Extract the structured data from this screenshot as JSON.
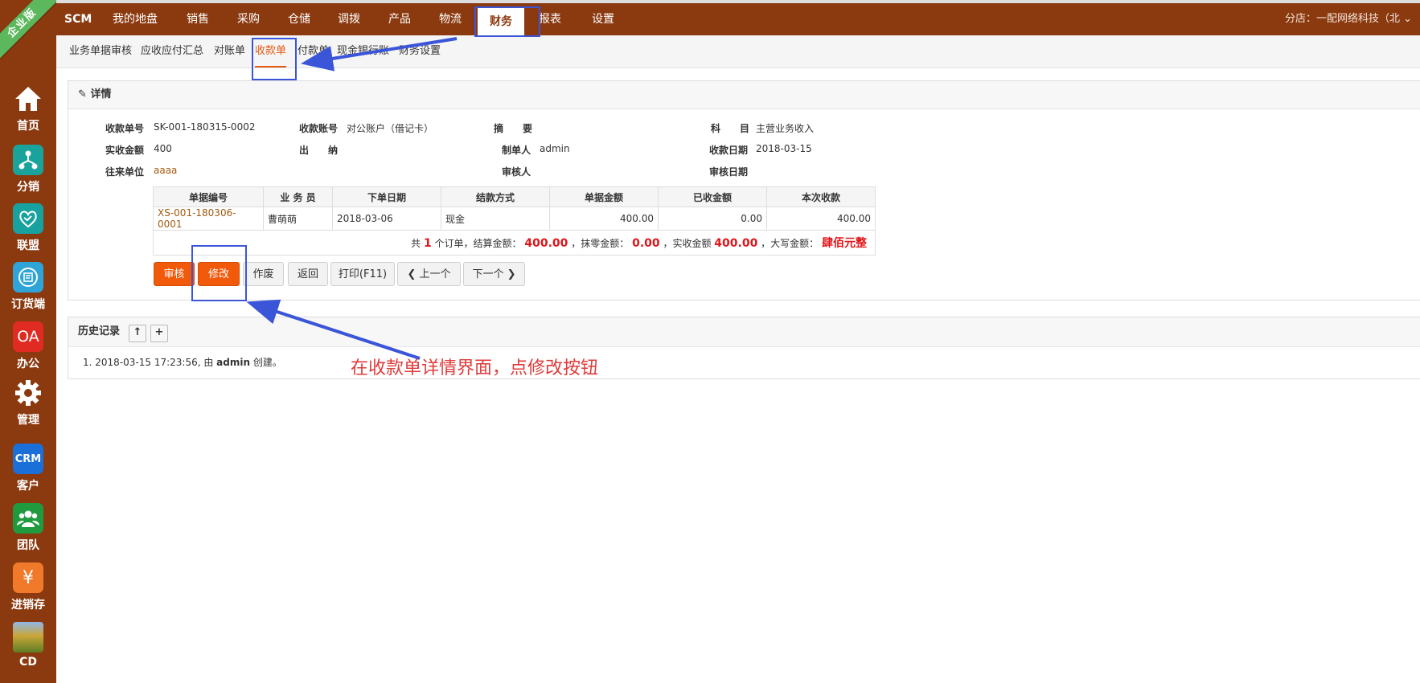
{
  "edition_ribbon": "企业版",
  "sidebar": {
    "items": [
      {
        "label": "首页",
        "icon": "home-icon"
      },
      {
        "label": "分销",
        "icon": "distribution-icon"
      },
      {
        "label": "联盟",
        "icon": "handshake-icon"
      },
      {
        "label": "订货端",
        "icon": "ordering-icon"
      },
      {
        "label": "办公",
        "icon": "oa-icon",
        "icon_text": "OA"
      },
      {
        "label": "管理",
        "icon": "gear-icon"
      },
      {
        "label": "客户",
        "icon": "crm-icon",
        "icon_text": "CRM"
      },
      {
        "label": "团队",
        "icon": "team-icon"
      },
      {
        "label": "进销存",
        "icon": "yen-icon",
        "icon_text": "¥"
      },
      {
        "label": "CD",
        "icon": "cd-thumbnail-icon"
      }
    ]
  },
  "topnav": {
    "items": [
      "SCM",
      "我的地盘",
      "销售",
      "采购",
      "仓储",
      "调拨",
      "产品",
      "物流",
      "财务",
      "报表",
      "设置"
    ],
    "active": "财务",
    "branch": "分店：一配网络科技（北"
  },
  "subnav": {
    "items": [
      "业务单据审核",
      "应收应付汇总",
      "对账单",
      "收款单",
      "付款单",
      "现金银行账",
      "财务设置"
    ],
    "active": "收款单"
  },
  "detail": {
    "title": "详情",
    "fields": {
      "receipt_no_label": "收款单号",
      "receipt_no": "SK-001-180315-0002",
      "account_label": "收款账号",
      "account": "对公账户（借记卡）",
      "summary_label": "摘　　要",
      "summary": "",
      "subject_label": "科　　目",
      "subject": "主营业务收入",
      "actual_label": "实收金额",
      "actual": "400",
      "cashier_label": "出　　纳",
      "cashier": "",
      "maker_label": "制单人",
      "maker": "admin",
      "date_label": "收款日期",
      "date": "2018-03-15",
      "partner_label": "往来单位",
      "partner": "aaaa",
      "auditor_label": "审核人",
      "auditor": "",
      "audit_date_label": "审核日期",
      "audit_date": ""
    },
    "table": {
      "headers": [
        "单据编号",
        "业 务 员",
        "下单日期",
        "结款方式",
        "单据金额",
        "已收金额",
        "本次收款"
      ],
      "rows": [
        [
          "XS-001-180306-0001",
          "曹萌萌",
          "2018-03-06",
          "现金",
          "400.00",
          "0.00",
          "400.00"
        ]
      ],
      "summary": {
        "p1": "共",
        "count": "1",
        "p2": "个订单，结算金额：",
        "settle": "400.00",
        "p3": "，抹零金额：",
        "rounding": "0.00",
        "p4": "，实收金额",
        "actual": "400.00",
        "p5": "，大写金额：",
        "uppercase": "肆佰元整"
      }
    },
    "buttons": {
      "audit": "审核",
      "edit": "修改",
      "void": "作废",
      "back": "返回",
      "print": "打印(F11)",
      "prev": "上一个",
      "next": "下一个"
    }
  },
  "history": {
    "title": "历史记录",
    "entries": [
      "1. 2018-03-15 17:23:56, 由 "
    ],
    "entry_user": "admin",
    "entry_action": " 创建。"
  },
  "annotation": "在收款单详情界面，点修改按钮",
  "colors": {
    "brand": "#8b3a10",
    "accent": "#f1590b",
    "highlight": "#3b55d9",
    "annotation": "#e03b3b"
  }
}
